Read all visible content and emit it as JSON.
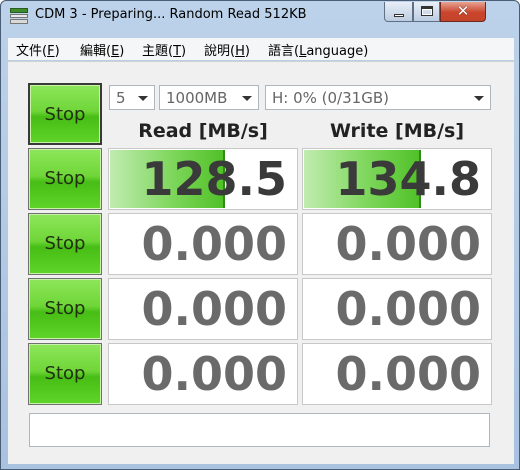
{
  "window": {
    "title": "CDM 3 - Preparing... Random Read 512KB",
    "close_glyph": "✕"
  },
  "menu": [
    {
      "label": "文件(",
      "key": "F",
      "tail": ")"
    },
    {
      "label": "編輯(",
      "key": "E",
      "tail": ")"
    },
    {
      "label": "主題(",
      "key": "T",
      "tail": ")"
    },
    {
      "label": "說明(",
      "key": "H",
      "tail": ")"
    },
    {
      "label": "語言(",
      "key": "L",
      "tail": "anguage)"
    }
  ],
  "controls": {
    "count": "5",
    "size": "1000MB",
    "drive": "H: 0% (0/31GB)"
  },
  "headers": {
    "read": "Read [MB/s]",
    "write": "Write [MB/s]"
  },
  "stop_label": "Stop",
  "rows": [
    {
      "read": "128.5",
      "write": "134.8",
      "read_fill": 0.61,
      "write_fill": 0.62
    },
    {
      "read": "0.000",
      "write": "0.000",
      "read_fill": 0,
      "write_fill": 0
    },
    {
      "read": "0.000",
      "write": "0.000",
      "read_fill": 0,
      "write_fill": 0
    },
    {
      "read": "0.000",
      "write": "0.000",
      "read_fill": 0,
      "write_fill": 0
    }
  ],
  "comment": ""
}
